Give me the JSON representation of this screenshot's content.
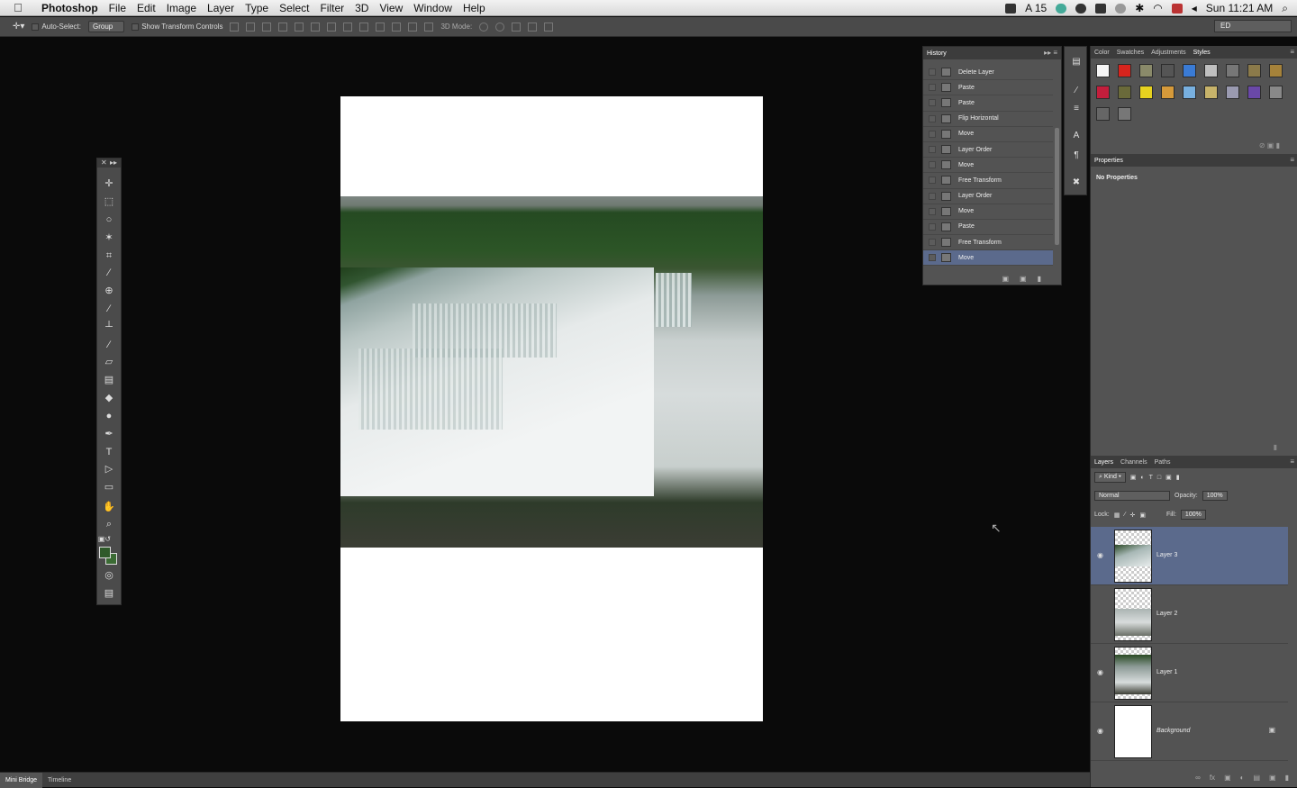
{
  "menubar": {
    "app": "Photoshop",
    "items": [
      "File",
      "Edit",
      "Image",
      "Layer",
      "Type",
      "Select",
      "Filter",
      "3D",
      "View",
      "Window",
      "Help"
    ],
    "status_num": "15",
    "clock": "Sun 11:21 AM"
  },
  "options": {
    "auto_select_label": "Auto-Select:",
    "auto_select_value": "Group",
    "show_transform_label": "Show Transform Controls",
    "mode_3d_label": "3D Mode:",
    "workspace": "ED"
  },
  "history": {
    "tab": "History",
    "items": [
      "Delete Layer",
      "Paste",
      "Paste",
      "Flip Horizontal",
      "Move",
      "Layer Order",
      "Move",
      "Free Transform",
      "Layer Order",
      "Move",
      "Paste",
      "Free Transform",
      "Move"
    ],
    "active_index": 12
  },
  "styles_panel": {
    "tabs": [
      "Color",
      "Swatches",
      "Adjustments",
      "Styles"
    ],
    "active_tab": "Styles",
    "swatch_colors": [
      "#f5f5f5",
      "#d7241d",
      "#8a8a6a",
      "#555",
      "#3a7bd5",
      "#bfbfbf",
      "#777",
      "#8b7a4a",
      "#a5823a",
      "#c31e3c",
      "#6a6a3a",
      "#e6d21f",
      "#d69a3a",
      "#78b0e0",
      "#c7b36a",
      "#9a9ab0",
      "#6a48a8",
      "#888",
      "#666",
      "#777"
    ]
  },
  "properties": {
    "tab": "Properties",
    "empty_label": "No Properties"
  },
  "layers": {
    "tabs": [
      "Layers",
      "Channels",
      "Paths"
    ],
    "kind_label": "Kind",
    "blend_mode": "Normal",
    "opacity_label": "Opacity:",
    "opacity": "100%",
    "lock_label": "Lock:",
    "fill_label": "Fill:",
    "fill": "100%",
    "items": [
      {
        "name": "Layer 3",
        "visible": true,
        "active": true
      },
      {
        "name": "Layer 2",
        "visible": false,
        "active": false
      },
      {
        "name": "Layer 1",
        "visible": true,
        "active": false
      },
      {
        "name": "Background",
        "visible": true,
        "active": false,
        "locked": true
      }
    ]
  },
  "bottom": {
    "tabs": [
      "Mini Bridge",
      "Timeline"
    ]
  }
}
